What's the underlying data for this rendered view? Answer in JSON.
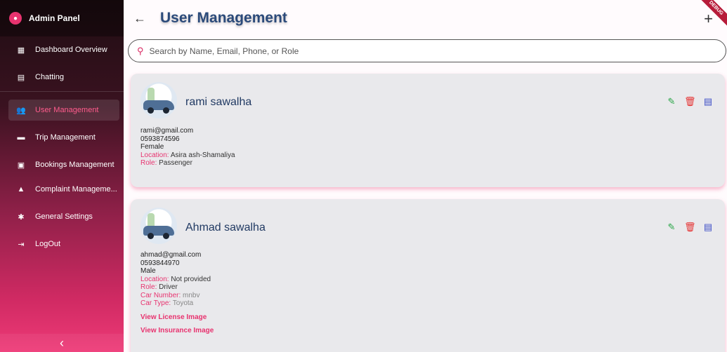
{
  "sidebar": {
    "title": "Admin Panel",
    "items": [
      {
        "label": "Dashboard Overview",
        "icon": "dashboard-icon"
      },
      {
        "label": "Chatting",
        "icon": "chat-icon"
      },
      {
        "label": "User Management",
        "icon": "people-icon",
        "active": true
      },
      {
        "label": "Trip Management",
        "icon": "car-icon"
      },
      {
        "label": "Bookings Management",
        "icon": "calendar-icon"
      },
      {
        "label": "Complaint Manageme...",
        "icon": "warning-icon"
      },
      {
        "label": "General Settings",
        "icon": "gear-icon"
      },
      {
        "label": "LogOut",
        "icon": "logout-icon"
      }
    ],
    "collapse_glyph": "‹"
  },
  "header": {
    "title": "User Management",
    "back_glyph": "←",
    "add_glyph": "+",
    "debug_banner": "DEBUG"
  },
  "search": {
    "placeholder": "Search by Name, Email, Phone, or Role",
    "value": ""
  },
  "users": [
    {
      "name": "rami sawalha",
      "email": "rami@gmail.com",
      "phone": "0593874596",
      "gender": "Female",
      "location_label": "Location:",
      "location": "Asira ash-Shamaliya",
      "role_label": "Role:",
      "role": "Passenger"
    },
    {
      "name": "Ahmad sawalha",
      "email": "ahmad@gmail.com",
      "phone": "0593844970",
      "gender": "Male",
      "location_label": "Location:",
      "location": "Not provided",
      "role_label": "Role:",
      "role": "Driver",
      "car_number_label": "Car Number:",
      "car_number": "mnbv",
      "car_type_label": "Car Type:",
      "car_type": "Toyota",
      "license_link": "View License Image",
      "insurance_link": "View Insurance Image"
    }
  ],
  "colors": {
    "accent": "#e8336f",
    "title": "#2b4a7a",
    "edit": "#2aa648",
    "delete": "#e53030",
    "message": "#3e4fc7"
  }
}
